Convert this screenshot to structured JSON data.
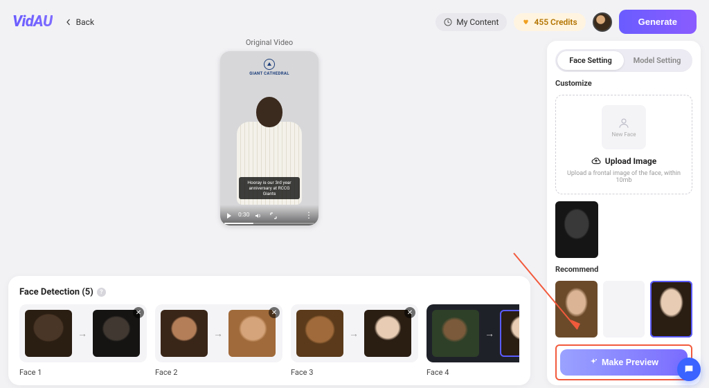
{
  "header": {
    "logo": "VidAU",
    "back": "Back",
    "my_content": "My Content",
    "credits": "455 Credits",
    "generate": "Generate"
  },
  "video": {
    "label": "Original Video",
    "brand": "GIANT CATHEDRAL",
    "caption": "Hooray is our 3rd year anniversary at RCCG Giants",
    "time": "0:30"
  },
  "detection": {
    "title": "Face Detection (5)",
    "faces": [
      "Face 1",
      "Face 2",
      "Face 3",
      "Face 4"
    ]
  },
  "sidebar": {
    "tabs": {
      "face": "Face Setting",
      "model": "Model Setting"
    },
    "customize": "Customize",
    "new_face": "New Face",
    "upload": "Upload Image",
    "upload_hint": "Upload a frontal image of the face, within 10mb",
    "recommend": "Recommend",
    "make_preview": "Make Preview"
  }
}
